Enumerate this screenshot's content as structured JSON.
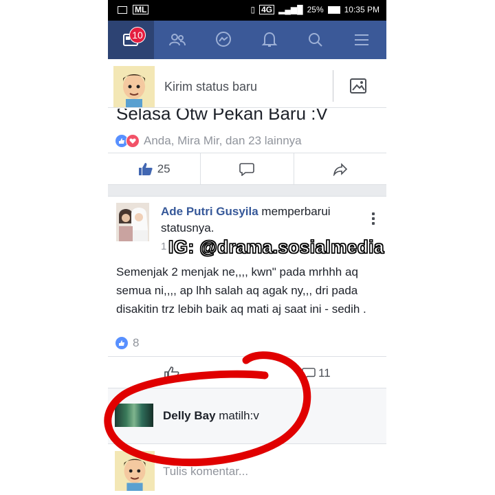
{
  "status_bar": {
    "carrier_badge": "ML",
    "network": "4G",
    "battery": "25%",
    "time": "10:35 PM"
  },
  "navbar": {
    "notification_count": "10",
    "icons": [
      "news-feed-icon",
      "friends-icon",
      "messenger-icon",
      "bell-icon",
      "search-icon",
      "menu-icon"
    ]
  },
  "composer": {
    "prompt": "Kirim status baru"
  },
  "post1": {
    "text": "Selasa Otw Pekan Baru :V",
    "reactions_text": "Anda, Mira Mir, dan 23 lainnya",
    "like_count": "25"
  },
  "post2": {
    "author": "Ade Putri Gusyila",
    "action": " memperbarui statusnya.",
    "timestamp": "1",
    "body": "Semenjak 2 menjak ne,,,,  kwn\" pada mrhhh aq semua ni,,,, ap lhh salah aq agak ny,,, dri pada disakitin trz lebih baik aq mati aj saat ini - sedih .",
    "like_count": "8",
    "comment_count": "11"
  },
  "watermark": "IG: @drama.sosialmedia",
  "comment": {
    "author": "Delly Bay",
    "text": " matilh:v"
  },
  "write_comment": {
    "placeholder": "Tulis komentar..."
  },
  "colors": {
    "brand": "#3b5998",
    "link": "#365899",
    "annotation": "#e00000"
  }
}
